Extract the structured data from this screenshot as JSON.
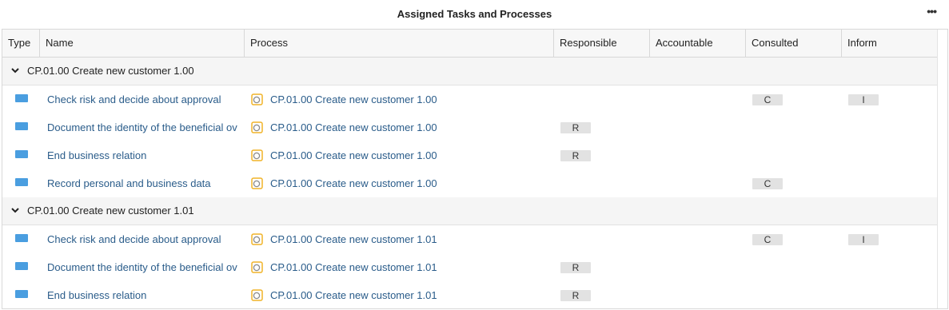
{
  "header": {
    "title": "Assigned Tasks and Processes",
    "more_label": "•••"
  },
  "columns": {
    "type": "Type",
    "name": "Name",
    "process": "Process",
    "responsible": "Responsible",
    "accountable": "Accountable",
    "consulted": "Consulted",
    "inform": "Inform"
  },
  "groups": [
    {
      "label": "CP.01.00 Create new customer 1.00",
      "rows": [
        {
          "name": "Check risk and decide about approval",
          "process": "CP.01.00 Create new customer 1.00",
          "responsible": "",
          "accountable": "",
          "consulted": "C",
          "inform": "I"
        },
        {
          "name": "Document the identity of the beneficial ov",
          "process": "CP.01.00 Create new customer 1.00",
          "responsible": "R",
          "accountable": "",
          "consulted": "",
          "inform": ""
        },
        {
          "name": "End business relation",
          "process": "CP.01.00 Create new customer 1.00",
          "responsible": "R",
          "accountable": "",
          "consulted": "",
          "inform": ""
        },
        {
          "name": "Record personal and business data",
          "process": "CP.01.00 Create new customer 1.00",
          "responsible": "",
          "accountable": "",
          "consulted": "C",
          "inform": ""
        }
      ]
    },
    {
      "label": "CP.01.00 Create new customer 1.01",
      "rows": [
        {
          "name": "Check risk and decide about approval",
          "process": "CP.01.00 Create new customer 1.01",
          "responsible": "",
          "accountable": "",
          "consulted": "C",
          "inform": "I"
        },
        {
          "name": "Document the identity of the beneficial ov",
          "process": "CP.01.00 Create new customer 1.01",
          "responsible": "R",
          "accountable": "",
          "consulted": "",
          "inform": ""
        },
        {
          "name": "End business relation",
          "process": "CP.01.00 Create new customer 1.01",
          "responsible": "R",
          "accountable": "",
          "consulted": "",
          "inform": ""
        }
      ]
    }
  ],
  "colors": {
    "task_icon": "#4a9ee0",
    "process_icon": "#f0b429",
    "link": "#2a5c8a"
  }
}
